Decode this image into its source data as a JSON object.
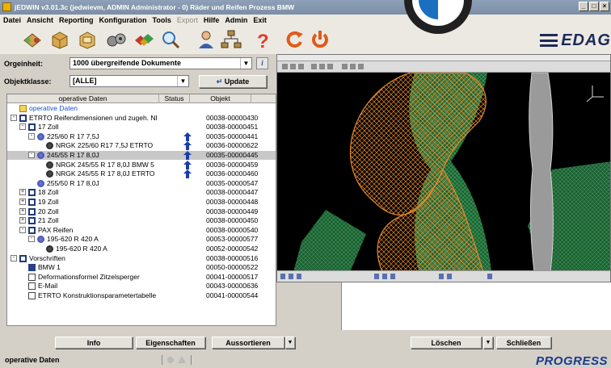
{
  "window": {
    "title": "jEDWIN v3.01.3c (jedwievm, ADMIN Administrator - 0) Räder und Reifen Prozess BMW",
    "buttons": [
      "_",
      "□",
      "×"
    ]
  },
  "menu": {
    "items": [
      {
        "label": "Datei",
        "enabled": true
      },
      {
        "label": "Ansicht",
        "enabled": true
      },
      {
        "label": "Reporting",
        "enabled": true
      },
      {
        "label": "Konfiguration",
        "enabled": true
      },
      {
        "label": "Tools",
        "enabled": true
      },
      {
        "label": "Export",
        "enabled": false
      },
      {
        "label": "Hilfe",
        "enabled": true
      },
      {
        "label": "Admin",
        "enabled": true
      },
      {
        "label": "Exit",
        "enabled": true
      }
    ]
  },
  "toolbar": {
    "icons": [
      "parts-icon",
      "box-icon",
      "package-icon",
      "wheels-icon",
      "gems-icon",
      "search-icon",
      "user-icon",
      "hierarchy-icon",
      "help-icon",
      "refresh-icon",
      "power-icon"
    ],
    "brand": "EDAG"
  },
  "filters": {
    "orgeinheit_label": "Orgeinheit:",
    "orgeinheit_value": "1000 übergreifende Dokumente",
    "info_button": "i",
    "objektklasse_label": "Objektklasse:",
    "objektklasse_value": "[ALLE]",
    "update_button": "Update"
  },
  "tree": {
    "columns": [
      "operative Daten",
      "Status",
      "Objekt"
    ],
    "rows": [
      {
        "depth": 0,
        "icon": "folder",
        "label": "operative Daten",
        "obj": "",
        "expander": "",
        "status": ""
      },
      {
        "depth": 0,
        "icon": "bracket",
        "label": "ETRTO Reifendimensionen und zugeh. NI",
        "obj": "00038-00000430",
        "expander": "-",
        "status": ""
      },
      {
        "depth": 1,
        "icon": "bracket",
        "label": "17 Zoll",
        "obj": "00038-00000451",
        "expander": "-",
        "status": ""
      },
      {
        "depth": 2,
        "icon": "wheel",
        "label": "225/60 R 17 7,5J",
        "obj": "00035-00000441",
        "expander": "-",
        "status": "arrow"
      },
      {
        "depth": 3,
        "icon": "rim",
        "label": "NRGK 225/60 R17 7,5J ETRTO",
        "obj": "00036-00000622",
        "expander": "",
        "status": "arrow"
      },
      {
        "depth": 2,
        "icon": "wheel",
        "label": "245/55 R 17 8,0J",
        "obj": "00035-00000445",
        "expander": "-",
        "status": "arrow",
        "selected": true
      },
      {
        "depth": 3,
        "icon": "rim",
        "label": "NRGK 245/55 R 17 8,0J BMW 5",
        "obj": "00036-00000459",
        "expander": "",
        "status": "arrow"
      },
      {
        "depth": 3,
        "icon": "rim",
        "label": "NRGK 245/55 R 17 8,0J ETRTO",
        "obj": "00036-00000460",
        "expander": "",
        "status": "arrow"
      },
      {
        "depth": 2,
        "icon": "wheel",
        "label": "255/50 R 17 8,0J",
        "obj": "00035-00000547",
        "expander": "",
        "status": ""
      },
      {
        "depth": 1,
        "icon": "bracket",
        "label": "18 Zoll",
        "obj": "00038-00000447",
        "expander": "+",
        "status": ""
      },
      {
        "depth": 1,
        "icon": "bracket",
        "label": "19 Zoll",
        "obj": "00038-00000448",
        "expander": "+",
        "status": ""
      },
      {
        "depth": 1,
        "icon": "bracket",
        "label": "20 Zoll",
        "obj": "00038-00000449",
        "expander": "+",
        "status": ""
      },
      {
        "depth": 1,
        "icon": "bracket",
        "label": "21 Zoll",
        "obj": "00038-00000450",
        "expander": "+",
        "status": ""
      },
      {
        "depth": 1,
        "icon": "bracket",
        "label": "PAX Reifen",
        "obj": "00038-00000540",
        "expander": "-",
        "status": ""
      },
      {
        "depth": 2,
        "icon": "wheel",
        "label": "195-620 R 420 A",
        "obj": "00053-00000577",
        "expander": "-",
        "status": ""
      },
      {
        "depth": 3,
        "icon": "rim",
        "label": "195-620 R 420 A",
        "obj": "00052-00000542",
        "expander": "",
        "status": ""
      },
      {
        "depth": 0,
        "icon": "bracket",
        "label": "Vorschriften",
        "obj": "00038-00000516",
        "expander": "-",
        "status": ""
      },
      {
        "depth": 1,
        "icon": "mbook",
        "label": "BMW 1",
        "obj": "00050-00000522",
        "expander": "",
        "status": ""
      },
      {
        "depth": 1,
        "icon": "doc",
        "label": "Deformationsformel Zitzelsperger",
        "obj": "00041-00000517",
        "expander": "",
        "status": ""
      },
      {
        "depth": 1,
        "icon": "mail",
        "label": "E-Mail",
        "obj": "00043-00000636",
        "expander": "",
        "status": ""
      },
      {
        "depth": 1,
        "icon": "doc",
        "label": "ETRTO Konstruktionsparametertabelle",
        "obj": "00041-00000544",
        "expander": "",
        "status": ""
      }
    ]
  },
  "bottom_buttons": {
    "info": "Info",
    "eigenschaften": "Eigenschaften",
    "ausssortieren": "Aussortieren",
    "loeschen": "Löschen",
    "schliessen": "Schließen"
  },
  "status": {
    "text": "operative Daten",
    "brand": "PROGRESS"
  },
  "colors": {
    "cad_background": "#000000",
    "mesh_orange": "#e8892a",
    "mesh_green": "#2f8a4c",
    "selection": "#c8c8c8",
    "status_arrow": "#1a3ea8"
  }
}
